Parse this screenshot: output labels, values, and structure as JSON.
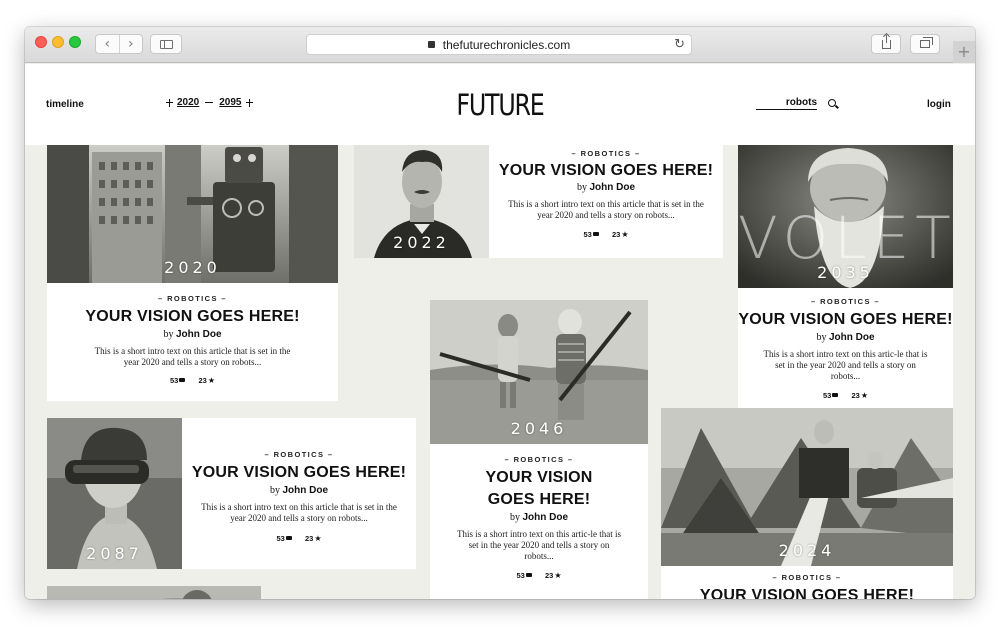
{
  "browser": {
    "url": "thefuturechronicles.com",
    "back_icon": "chevron-left",
    "forward_icon": "chevron-right",
    "reload_icon": "reload",
    "new_tab_label": "+"
  },
  "header": {
    "timeline": "timeline",
    "range_from": "2020",
    "range_to": "2095",
    "logo": "FUTURE",
    "search_value": "robots",
    "login": "login"
  },
  "cards": [
    {
      "year": "2020",
      "category": "– ROBOTICS –",
      "title": "YOUR VISION GOES HERE!",
      "by": "by",
      "author": "John Doe",
      "intro": "This is a short intro text on this article that is set in the year 2020 and tells a story on robots...",
      "comments": "53",
      "stars": "23"
    },
    {
      "year": "2022",
      "category": "– ROBOTICS –",
      "title": "YOUR VISION GOES HERE!",
      "by": "by",
      "author": "John Doe",
      "intro": "This is a short intro text on this article that is set in the year 2020 and tells a story on robots...",
      "comments": "53",
      "stars": "23"
    },
    {
      "year": "2035",
      "category": "– ROBOTICS –",
      "title": "YOUR VISION GOES HERE!",
      "by": "by",
      "author": "John Doe",
      "intro": "This is a short intro text on this artic-le that is set in the year 2020 and tells a story on robots...",
      "comments": "53",
      "stars": "23",
      "image_text": "VOLETT"
    },
    {
      "year": "2087",
      "category": "– ROBOTICS –",
      "title": "YOUR VISION GOES HERE!",
      "by": "by",
      "author": "John Doe",
      "intro": "This is a short intro text on this article that is set in the year 2020 and tells a story on robots...",
      "comments": "53",
      "stars": "23"
    },
    {
      "year": "2046",
      "category": "– ROBOTICS –",
      "title": "YOUR VISION GOES HERE!",
      "by": "by",
      "author": "John Doe",
      "intro": "This is a short intro text on this artic-le that is set in the year 2020 and tells a story on robots...",
      "comments": "53",
      "stars": "23"
    },
    {
      "year": "2024",
      "category": "– ROBOTICS –",
      "title": "YOUR VISION GOES HERE!"
    }
  ]
}
